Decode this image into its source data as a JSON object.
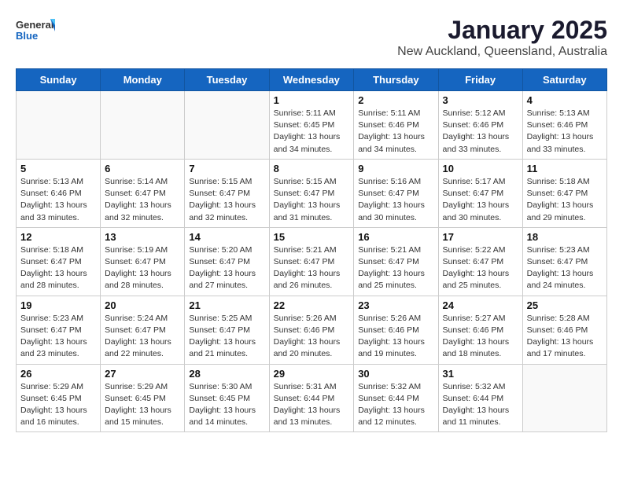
{
  "header": {
    "logo_general": "General",
    "logo_blue": "Blue",
    "title": "January 2025",
    "subtitle": "New Auckland, Queensland, Australia"
  },
  "weekdays": [
    "Sunday",
    "Monday",
    "Tuesday",
    "Wednesday",
    "Thursday",
    "Friday",
    "Saturday"
  ],
  "weeks": [
    [
      {
        "day": "",
        "info": ""
      },
      {
        "day": "",
        "info": ""
      },
      {
        "day": "",
        "info": ""
      },
      {
        "day": "1",
        "info": "Sunrise: 5:11 AM\nSunset: 6:45 PM\nDaylight: 13 hours\nand 34 minutes."
      },
      {
        "day": "2",
        "info": "Sunrise: 5:11 AM\nSunset: 6:46 PM\nDaylight: 13 hours\nand 34 minutes."
      },
      {
        "day": "3",
        "info": "Sunrise: 5:12 AM\nSunset: 6:46 PM\nDaylight: 13 hours\nand 33 minutes."
      },
      {
        "day": "4",
        "info": "Sunrise: 5:13 AM\nSunset: 6:46 PM\nDaylight: 13 hours\nand 33 minutes."
      }
    ],
    [
      {
        "day": "5",
        "info": "Sunrise: 5:13 AM\nSunset: 6:46 PM\nDaylight: 13 hours\nand 33 minutes."
      },
      {
        "day": "6",
        "info": "Sunrise: 5:14 AM\nSunset: 6:47 PM\nDaylight: 13 hours\nand 32 minutes."
      },
      {
        "day": "7",
        "info": "Sunrise: 5:15 AM\nSunset: 6:47 PM\nDaylight: 13 hours\nand 32 minutes."
      },
      {
        "day": "8",
        "info": "Sunrise: 5:15 AM\nSunset: 6:47 PM\nDaylight: 13 hours\nand 31 minutes."
      },
      {
        "day": "9",
        "info": "Sunrise: 5:16 AM\nSunset: 6:47 PM\nDaylight: 13 hours\nand 30 minutes."
      },
      {
        "day": "10",
        "info": "Sunrise: 5:17 AM\nSunset: 6:47 PM\nDaylight: 13 hours\nand 30 minutes."
      },
      {
        "day": "11",
        "info": "Sunrise: 5:18 AM\nSunset: 6:47 PM\nDaylight: 13 hours\nand 29 minutes."
      }
    ],
    [
      {
        "day": "12",
        "info": "Sunrise: 5:18 AM\nSunset: 6:47 PM\nDaylight: 13 hours\nand 28 minutes."
      },
      {
        "day": "13",
        "info": "Sunrise: 5:19 AM\nSunset: 6:47 PM\nDaylight: 13 hours\nand 28 minutes."
      },
      {
        "day": "14",
        "info": "Sunrise: 5:20 AM\nSunset: 6:47 PM\nDaylight: 13 hours\nand 27 minutes."
      },
      {
        "day": "15",
        "info": "Sunrise: 5:21 AM\nSunset: 6:47 PM\nDaylight: 13 hours\nand 26 minutes."
      },
      {
        "day": "16",
        "info": "Sunrise: 5:21 AM\nSunset: 6:47 PM\nDaylight: 13 hours\nand 25 minutes."
      },
      {
        "day": "17",
        "info": "Sunrise: 5:22 AM\nSunset: 6:47 PM\nDaylight: 13 hours\nand 25 minutes."
      },
      {
        "day": "18",
        "info": "Sunrise: 5:23 AM\nSunset: 6:47 PM\nDaylight: 13 hours\nand 24 minutes."
      }
    ],
    [
      {
        "day": "19",
        "info": "Sunrise: 5:23 AM\nSunset: 6:47 PM\nDaylight: 13 hours\nand 23 minutes."
      },
      {
        "day": "20",
        "info": "Sunrise: 5:24 AM\nSunset: 6:47 PM\nDaylight: 13 hours\nand 22 minutes."
      },
      {
        "day": "21",
        "info": "Sunrise: 5:25 AM\nSunset: 6:47 PM\nDaylight: 13 hours\nand 21 minutes."
      },
      {
        "day": "22",
        "info": "Sunrise: 5:26 AM\nSunset: 6:46 PM\nDaylight: 13 hours\nand 20 minutes."
      },
      {
        "day": "23",
        "info": "Sunrise: 5:26 AM\nSunset: 6:46 PM\nDaylight: 13 hours\nand 19 minutes."
      },
      {
        "day": "24",
        "info": "Sunrise: 5:27 AM\nSunset: 6:46 PM\nDaylight: 13 hours\nand 18 minutes."
      },
      {
        "day": "25",
        "info": "Sunrise: 5:28 AM\nSunset: 6:46 PM\nDaylight: 13 hours\nand 17 minutes."
      }
    ],
    [
      {
        "day": "26",
        "info": "Sunrise: 5:29 AM\nSunset: 6:45 PM\nDaylight: 13 hours\nand 16 minutes."
      },
      {
        "day": "27",
        "info": "Sunrise: 5:29 AM\nSunset: 6:45 PM\nDaylight: 13 hours\nand 15 minutes."
      },
      {
        "day": "28",
        "info": "Sunrise: 5:30 AM\nSunset: 6:45 PM\nDaylight: 13 hours\nand 14 minutes."
      },
      {
        "day": "29",
        "info": "Sunrise: 5:31 AM\nSunset: 6:44 PM\nDaylight: 13 hours\nand 13 minutes."
      },
      {
        "day": "30",
        "info": "Sunrise: 5:32 AM\nSunset: 6:44 PM\nDaylight: 13 hours\nand 12 minutes."
      },
      {
        "day": "31",
        "info": "Sunrise: 5:32 AM\nSunset: 6:44 PM\nDaylight: 13 hours\nand 11 minutes."
      },
      {
        "day": "",
        "info": ""
      }
    ]
  ]
}
